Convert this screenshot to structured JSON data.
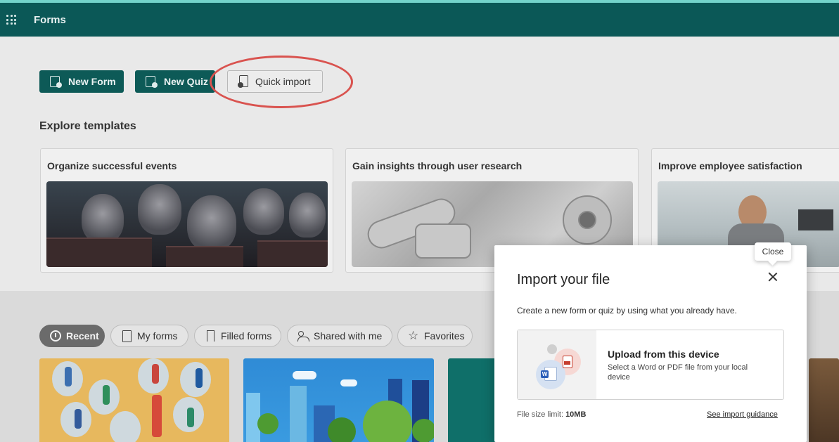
{
  "app": {
    "title": "Forms"
  },
  "actions": {
    "new_form": "New Form",
    "new_quiz": "New Quiz",
    "quick_import": "Quick import"
  },
  "templates": {
    "section_title": "Explore templates",
    "items": [
      {
        "title": "Organize successful events"
      },
      {
        "title": "Gain insights through user research"
      },
      {
        "title": "Improve employee satisfaction"
      }
    ]
  },
  "filters": {
    "items": [
      {
        "label": "Recent",
        "icon": "clock-icon",
        "active": true
      },
      {
        "label": "My forms",
        "icon": "document-icon"
      },
      {
        "label": "Filled forms",
        "icon": "bookmark-icon"
      },
      {
        "label": "Shared with me",
        "icon": "people-icon"
      },
      {
        "label": "Favorites",
        "icon": "star-icon"
      }
    ]
  },
  "dialog": {
    "title": "Import your file",
    "close_tooltip": "Close",
    "description": "Create a new form or quiz by using what you already have.",
    "upload": {
      "title": "Upload from this device",
      "description": "Select a Word or PDF file from your local device",
      "word_badge": "W"
    },
    "size_limit_label": "File size limit:",
    "size_limit_value": "10MB",
    "guidance_link": "See import guidance"
  },
  "colors": {
    "app_bar": "#0b5857",
    "accent_line": "#74d3cb",
    "primary_button": "#0d5a57",
    "highlight_ring": "#d9534f"
  }
}
